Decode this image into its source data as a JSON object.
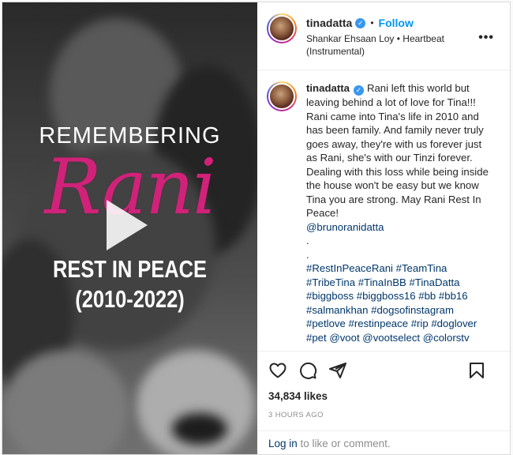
{
  "post": {
    "username": "tinadatta",
    "follow_label": "Follow",
    "separator": "•",
    "music": "Shankar Ehsaan Loy • Heartbeat (Instrumental)",
    "more_icon": "more-options-icon"
  },
  "media": {
    "overlay_title": "REMEMBERING",
    "overlay_name": "Rani",
    "overlay_subtitle": "REST IN PEACE",
    "overlay_years": "(2010-2022)",
    "play_icon": "play-icon"
  },
  "caption": {
    "username": "tinadatta",
    "body": "Rani left this world but leaving behind a lot of love for Tina!!! Rani came into Tina's life in 2010 and has been family. And family never truly goes away, they're with us forever just as Rani, she's with our Tinzi forever. Dealing with this loss while being inside the house won't be easy but we know Tina you are strong. May Rani Rest In Peace!",
    "mention": "@brunoranidatta",
    "dot1": ".",
    "dot2": ".",
    "tags_line1": "#RestInPeaceRani #TeamTina",
    "tags_line2": "#TribeTina #TinaInBB #TinaDatta",
    "tags_line3": "#biggboss #biggboss16 #bb #bb16",
    "tags_line4": "#salmankhan #dogsofinstagram",
    "tags_line5": "#petlove #restinpeace #rip #doglover",
    "tags_line6": "#pet @voot @vootselect @colorstv"
  },
  "actions": {
    "like_icon": "heart-icon",
    "comment_icon": "comment-icon",
    "share_icon": "share-icon",
    "save_icon": "bookmark-icon"
  },
  "stats": {
    "likes": "34,834 likes",
    "timestamp": "3 HOURS AGO"
  },
  "footer": {
    "login_link": "Log in",
    "login_rest": " to like or comment."
  },
  "colors": {
    "link": "#00376b",
    "follow": "#0095f6",
    "verified": "#3897f0",
    "overlay_name": "#d1227a"
  }
}
